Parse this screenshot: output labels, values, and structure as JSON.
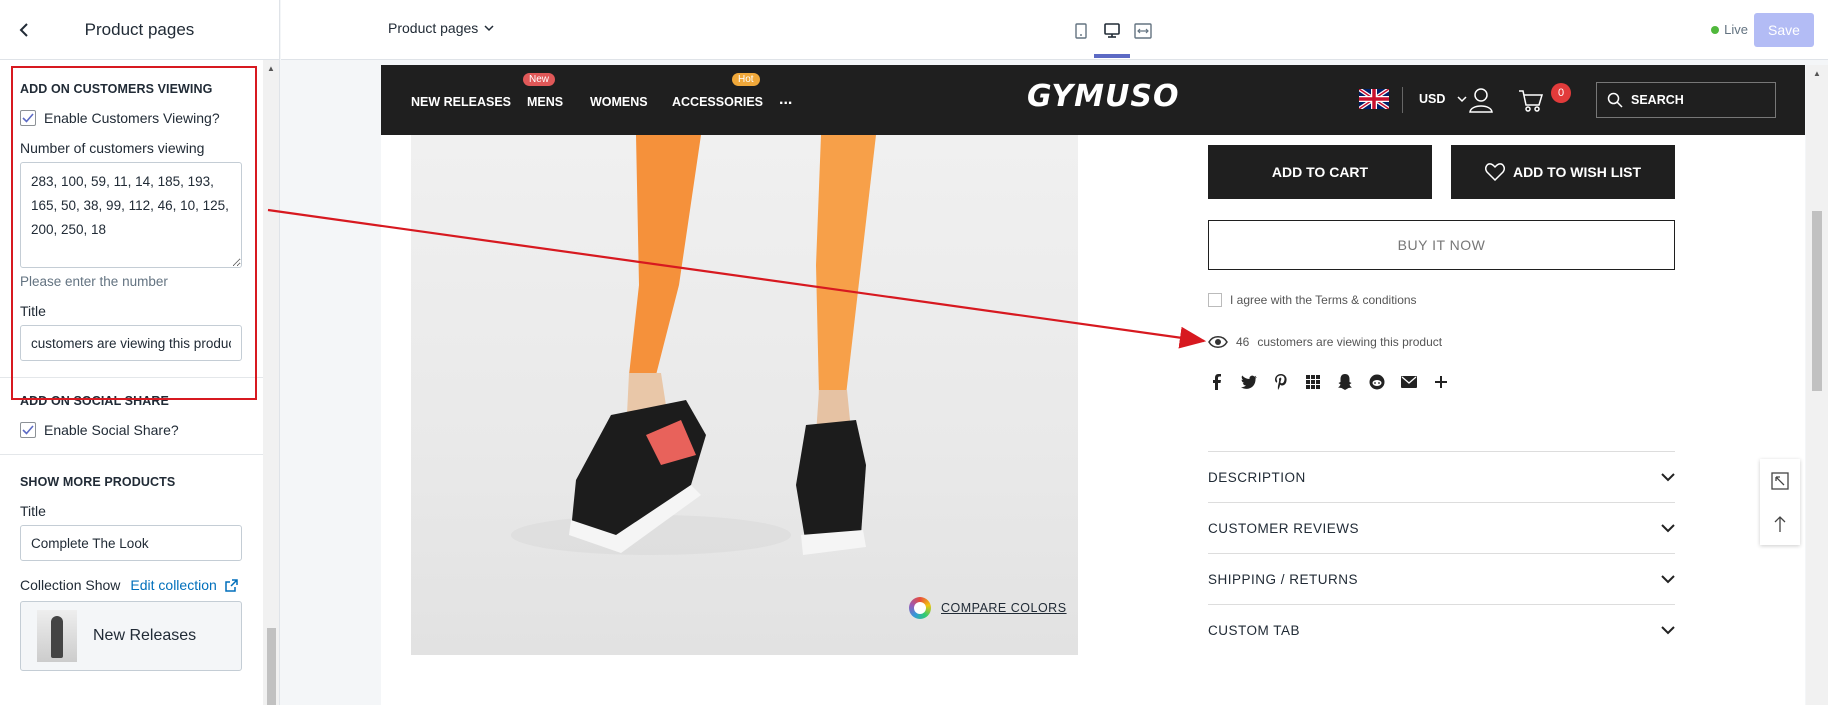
{
  "sidebar": {
    "title": "Product pages",
    "sections": {
      "customers_viewing": {
        "heading": "ADD ON CUSTOMERS VIEWING",
        "enable_label": "Enable Customers Viewing?",
        "number_label": "Number of customers viewing",
        "number_value": "283, 100, 59, 11, 14, 185, 193, 165, 50, 38, 99, 112, 46, 10, 125, 200, 250, 18",
        "help": "Please enter the number",
        "title_label": "Title",
        "title_value": "customers are viewing this product"
      },
      "social_share": {
        "heading": "ADD ON SOCIAL SHARE",
        "enable_label": "Enable Social Share?"
      },
      "more_products": {
        "heading": "SHOW MORE PRODUCTS",
        "title_label": "Title",
        "title_value": "Complete The Look",
        "collection_label": "Collection Show",
        "edit_link": "Edit collection",
        "collection_name": "New Releases"
      }
    }
  },
  "topbar": {
    "page_select": "Product pages",
    "live": "Live",
    "save": "Save"
  },
  "store": {
    "nav": {
      "new_releases": "NEW RELEASES",
      "mens": "MENS",
      "mens_badge": "New",
      "womens": "WOMENS",
      "accessories": "ACCESSORIES",
      "accessories_badge": "Hot",
      "more": "..."
    },
    "logo": "GYMUSO",
    "currency": "USD",
    "cart_count": "0",
    "search": "SEARCH"
  },
  "product": {
    "compare_colors": "COMPARE COLORS",
    "add_to_cart": "ADD TO CART",
    "add_to_wishlist": "ADD TO WISH LIST",
    "buy_now": "BUY IT NOW",
    "agree": "I agree with the Terms & conditions",
    "viewing_count": "46",
    "viewing_text": "customers are viewing this product",
    "tabs": [
      "DESCRIPTION",
      "CUSTOMER REVIEWS",
      "SHIPPING / RETURNS",
      "CUSTOM TAB"
    ]
  },
  "colors": {
    "accent": "#5c6ac4",
    "highlight": "#d71920",
    "store_header": "#1f1f1f",
    "legging": "#f5913b"
  }
}
